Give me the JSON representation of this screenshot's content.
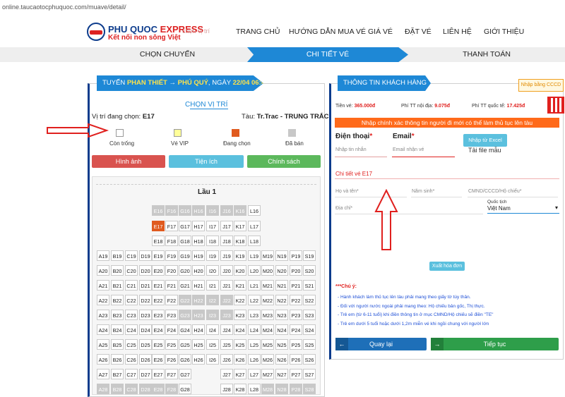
{
  "url": "online.taucaotocphuquoc.com/muave/detail/",
  "logo": {
    "brand1": "PHU QUOC ",
    "brand2": "EXPRESS",
    "slogan": "Kết nối non sông Việt",
    "ghost_text": "chọn vị trí"
  },
  "nav": [
    "TRANG CHỦ",
    "HƯỚNG DẪN MUA VÉ",
    "GIÁ VÉ",
    "ĐẶT VÉ",
    "LIÊN HỆ",
    "GIỚI THIỆU"
  ],
  "steps": [
    "CHỌN CHUYẾN",
    "CHI TIẾT VÉ",
    "THANH TOÁN"
  ],
  "trip": {
    "prefix": "TUYẾN ",
    "from": "PHAN THIẾT",
    "arrow": " → ",
    "to": "PHÚ QUÝ",
    "date_prefix": ", NGÀY ",
    "date": "22/04 06:45"
  },
  "seat_panel": {
    "title": "CHỌN VỊ TRÍ",
    "current_label": "Vị trí đang chọn: ",
    "current": "E17",
    "ship_label": "Tàu: ",
    "ship": "Tr.Trac - TRUNG TRẮC",
    "deck": "Lầu 1"
  },
  "legend": [
    {
      "label": "Còn trống",
      "color": "#ffffff"
    },
    {
      "label": "Vé VIP",
      "color": "#ffff99"
    },
    {
      "label": "Đang chọn",
      "color": "#e05a1e"
    },
    {
      "label": "Đã bán",
      "color": "#c8c8c8"
    }
  ],
  "seat_buttons": [
    {
      "label": "Hình ảnh",
      "color": "#d9534f"
    },
    {
      "label": "Tiện ích",
      "color": "#5bc0de"
    },
    {
      "label": "Chính sách",
      "color": "#5cb85c"
    }
  ],
  "seat_rows": [
    {
      "r": 16,
      "cols": [
        "E",
        "F",
        "G",
        "H",
        "I",
        "J",
        "K",
        "L"
      ]
    },
    {
      "r": 17,
      "cols": [
        "E",
        "F",
        "G",
        "H",
        "I",
        "J",
        "K",
        "L"
      ]
    },
    {
      "r": 18,
      "cols": [
        "E",
        "F",
        "G",
        "H",
        "I",
        "J",
        "K",
        "L"
      ]
    },
    {
      "r": 19,
      "cols": [
        "A",
        "B",
        "C",
        "D",
        "E",
        "F",
        "G",
        "H",
        "I",
        "J",
        "K",
        "L",
        "M",
        "N",
        "O",
        "P",
        "S"
      ]
    },
    {
      "r": 20,
      "cols": [
        "A",
        "B",
        "C",
        "D",
        "E",
        "F",
        "G",
        "H",
        "I",
        "J",
        "K",
        "L",
        "M",
        "N",
        "O",
        "P",
        "S"
      ]
    },
    {
      "r": 21,
      "cols": [
        "A",
        "B",
        "C",
        "D",
        "E",
        "F",
        "G",
        "H",
        "I",
        "J",
        "K",
        "L",
        "M",
        "N",
        "O",
        "P",
        "S"
      ]
    },
    {
      "r": 22,
      "cols": [
        "A",
        "B",
        "C",
        "D",
        "E",
        "F",
        "G",
        "H",
        "I",
        "J",
        "K",
        "L",
        "M",
        "N",
        "O",
        "P",
        "S"
      ]
    },
    {
      "r": 23,
      "cols": [
        "A",
        "B",
        "C",
        "D",
        "E",
        "F",
        "G",
        "H",
        "I",
        "J",
        "K",
        "L",
        "M",
        "N",
        "O",
        "P",
        "S"
      ]
    },
    {
      "r": 24,
      "cols": [
        "A",
        "B",
        "C",
        "D",
        "E",
        "F",
        "G",
        "H",
        "I",
        "J",
        "K",
        "L",
        "M",
        "N",
        "O",
        "P",
        "S"
      ]
    },
    {
      "r": 25,
      "cols": [
        "A",
        "B",
        "C",
        "D",
        "E",
        "F",
        "G",
        "H",
        "I",
        "J",
        "K",
        "L",
        "M",
        "N",
        "O",
        "P",
        "S"
      ]
    },
    {
      "r": 26,
      "cols": [
        "A",
        "B",
        "C",
        "D",
        "E",
        "F",
        "G",
        "H",
        "I",
        "J",
        "K",
        "L",
        "M",
        "N",
        "O",
        "P",
        "S"
      ]
    },
    {
      "r": 27,
      "cols": [
        "A",
        "B",
        "C",
        "D",
        "E",
        "F",
        "G",
        "",
        "",
        "J",
        "K",
        "L",
        "M",
        "N",
        "O",
        "P",
        "S"
      ]
    },
    {
      "r": 28,
      "cols": [
        "A",
        "B",
        "C",
        "D",
        "E",
        "F",
        "G",
        "",
        "",
        "J",
        "K",
        "L",
        "M",
        "N",
        "O",
        "P",
        "S"
      ]
    }
  ],
  "sold": [
    "E16",
    "F16",
    "G16",
    "H16",
    "I16",
    "J16",
    "K16",
    "G22",
    "H22",
    "I22",
    "J22",
    "G23",
    "H23",
    "I23",
    "J23",
    "A28",
    "B28",
    "C28",
    "D28",
    "E28",
    "F28",
    "M28",
    "N28",
    "O28",
    "P28",
    "S28"
  ],
  "selected": "E17",
  "customer": {
    "title": "THÔNG TIN KHÁCH HÀNG",
    "cccd_button": "Nhập bằng CCCD",
    "fees": [
      {
        "label": "Tiền vé: ",
        "value": "365.000đ"
      },
      {
        "label": "Phí TT nội địa: ",
        "value": "9.075đ"
      },
      {
        "label": "Phí TT quốc tế: ",
        "value": "17.425đ"
      }
    ],
    "banner": "Nhập chính xác thông tin người đi mới có thể làm thủ tục lên tàu",
    "phone_label": "Điện thoại",
    "phone_placeholder": "Nhập tin nhắn",
    "email_label": "Email",
    "email_placeholder": "Email nhận vé",
    "excel_button": "Nhập từ Excel",
    "excel_template": "Tải file mẫu",
    "detail_title": "Chi tiết vé E17",
    "fullname": "Họ và tên*",
    "birthyear": "Năm sinh*",
    "id_number": "CMND/CCCD/Hộ chiếu*",
    "address": "Địa chỉ*",
    "nationality_label": "Quốc tịch",
    "nationality_value": "Việt Nam",
    "invoice_button": "Xuất hóa đơn",
    "note_title": "***Chú ý:",
    "notes": [
      "- Hành khách làm thủ tục lên tàu phải mang theo giấy tờ tùy thân.",
      "- Đối với người nước ngoài phải mang theo: Hộ chiếu bản gốc, Thị thực.",
      "- Trẻ em (từ 6-11 tuổi) khi điền thông tin ở mục CMND/Hộ chiếu sẽ điền \"TE\"",
      "- Trẻ em dưới 5 tuổi hoặc dưới 1,2m miễn vé khi ngồi chung với người lớn"
    ],
    "back_button": "Quay lại",
    "next_button": "Tiếp tục"
  },
  "colors": {
    "primary": "#1e88d6",
    "red": "#e0201e",
    "green": "#2e9e4a",
    "orange_banner": "#ff6a1a"
  }
}
